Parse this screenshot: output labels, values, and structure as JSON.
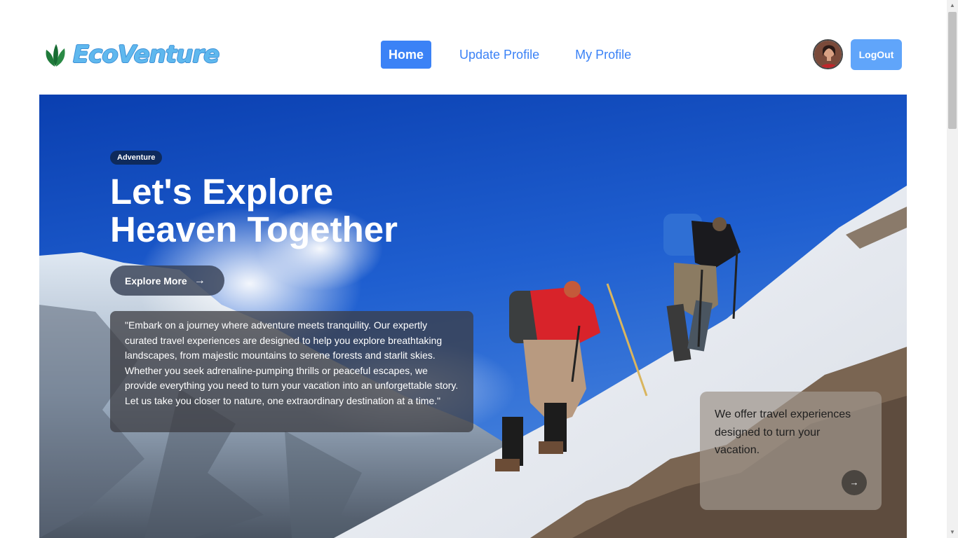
{
  "brand": {
    "name": "EcoVenture",
    "icon": "leaf-icon",
    "colors": {
      "text": "#5fb8ee",
      "leaf": "#1f7a3a"
    }
  },
  "nav": {
    "items": [
      {
        "label": "Home",
        "active": true
      },
      {
        "label": "Update Profile",
        "active": false
      },
      {
        "label": "My Profile",
        "active": false
      }
    ],
    "logout_label": "LogOut",
    "colors": {
      "accent": "#3b82f6",
      "logout": "#60a5fa"
    }
  },
  "hero": {
    "badge": "Adventure",
    "title_line1": "Let's Explore",
    "title_line2": "Heaven Together",
    "cta_label": "Explore More",
    "cta_icon": "arrow-right-icon",
    "description": "\"Embark on a journey where adventure meets tranquility. Our expertly curated travel experiences are designed to help you explore breathtaking landscapes, from majestic mountains to serene forests and starlit skies. Whether you seek adrenaline-pumping thrills or peaceful escapes, we provide everything you need to turn your vacation into an unforgettable story. Let us take you closer to nature, one extraordinary destination at a time.\"",
    "offer_card": {
      "text": "We offer travel experiences designed to turn your vacation.",
      "icon": "arrow-right-icon"
    }
  }
}
